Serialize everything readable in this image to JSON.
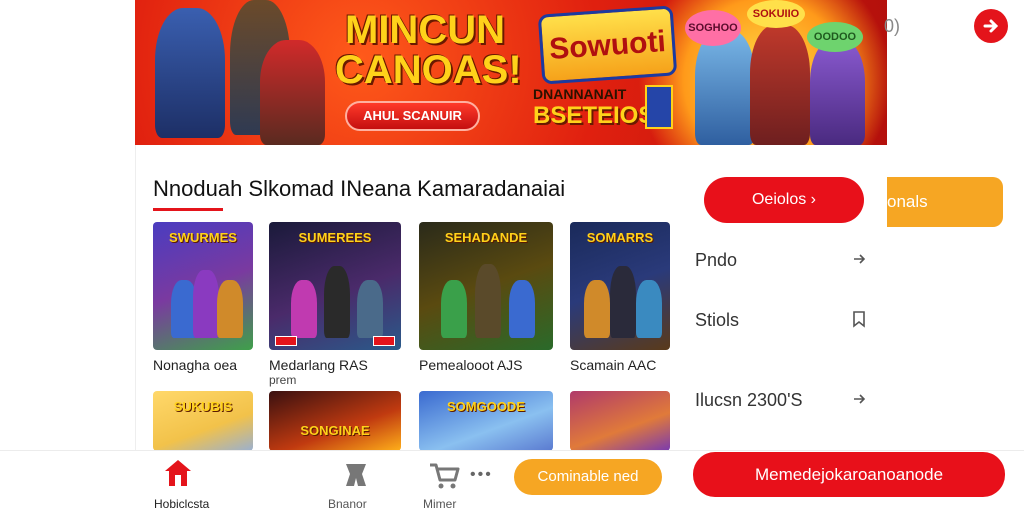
{
  "banner": {
    "title": "MINCUN CANOAS!",
    "button_label": "AHUL SCANUIR",
    "logo_text": "Sowuoti",
    "sub_line1": "DNANNANAIT",
    "sub_line2": "BSETEIOSI",
    "bubbles": [
      "SOGHOO",
      "SOKUIIO",
      "OODOO"
    ]
  },
  "top_right": {
    "circle_icon": "logout-icon",
    "glyph": "0)"
  },
  "section": {
    "title": "Nnoduah Slkomad INeana Kamaradanaiai"
  },
  "cards": [
    {
      "thumb_title": "SWURMES",
      "label": "Nonagha oea",
      "sub": ""
    },
    {
      "thumb_title": "SUMEREES",
      "label": "Medarlang RAS",
      "sub": "prem"
    },
    {
      "thumb_title": "SEHADANDE",
      "label": "Pemealooot AJS",
      "sub": ""
    },
    {
      "thumb_title": "SOMARRS",
      "label": "Scamain AAC",
      "sub": ""
    },
    {
      "thumb_title": "SUKUBIS",
      "label": "",
      "sub": ""
    },
    {
      "thumb_title": "SONGINAE",
      "label": "",
      "sub": ""
    },
    {
      "thumb_title": "SOMGOODE",
      "label": "",
      "sub": ""
    },
    {
      "thumb_title": "",
      "label": "",
      "sub": ""
    }
  ],
  "menu": {
    "details_button": "Oeiolos ›",
    "items": [
      {
        "label": "Pndo",
        "icon": "arrow-right-icon"
      },
      {
        "label": "Stiols",
        "icon": "bookmark-icon"
      },
      {
        "label": "Ilucsn 2300'S",
        "icon": "arrow-right-icon"
      }
    ],
    "side_button": "onals"
  },
  "bottom_nav": {
    "home_label": "Hobiclcsta",
    "item2_label": "Bnanor",
    "item3_label": "Mimer",
    "orange_button": "Cominable ned",
    "red_button": "Memedejokaroanoanode"
  },
  "colors": {
    "accent_red": "#e8101a",
    "accent_orange": "#f6a623"
  }
}
